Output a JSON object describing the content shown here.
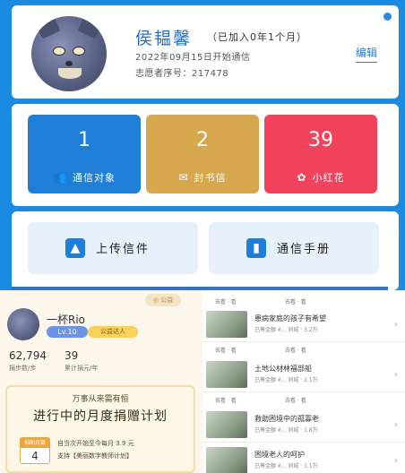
{
  "profile": {
    "name": "侯韫馨",
    "duration": "（已加入0年1个月）",
    "start_date": "2022年09月15日开始通信",
    "serial": "志愿者序号：217478",
    "edit_label": "编辑"
  },
  "stats": [
    {
      "value": "1",
      "label": "通信对象",
      "icon": "people-icon",
      "color": "#1f7fd8"
    },
    {
      "value": "2",
      "label": "封书信",
      "icon": "letter-icon",
      "color": "#d6a74d"
    },
    {
      "value": "39",
      "label": "小红花",
      "icon": "flower-icon",
      "color": "#f1435c"
    }
  ],
  "actions": [
    {
      "label": "上传信件",
      "icon": "upload-icon"
    },
    {
      "label": "通信手册",
      "icon": "book-icon"
    }
  ],
  "mini_profile": {
    "name": "一杯Rio",
    "level": "Lv.10",
    "tag": "公益达人",
    "count1": "62,794",
    "count2": "39",
    "count1_label": "捐步数/步",
    "count2_label": "累计捐元/年"
  },
  "plan": {
    "title": "万事从来需有恒",
    "heading": "进行中的月度捐赠计划",
    "cal_label": "捐助月数",
    "cal_value": "4",
    "line1": "自当次开始至今每月 3.9 元",
    "line2": "支持【美丽数字教师计划】"
  },
  "feed": {
    "items": [
      {
        "title": "患病家庭的孩子有希望",
        "sub": "已筹金额 ¥... 同城 · 3.2万"
      },
      {
        "title": "土地公材林福部船",
        "sub": "已筹金额 ¥... 同城 · 2.1万"
      },
      {
        "title": "救助困境中的孤寡老",
        "sub": "已筹金额 ¥... 同城 · 1.8万"
      },
      {
        "title": "困境老人的呵护",
        "sub": "已筹金额 ¥... 同城 · 1.1万"
      }
    ],
    "footer_a": "去看 · 看",
    "footer_b": "去看 · 看"
  }
}
